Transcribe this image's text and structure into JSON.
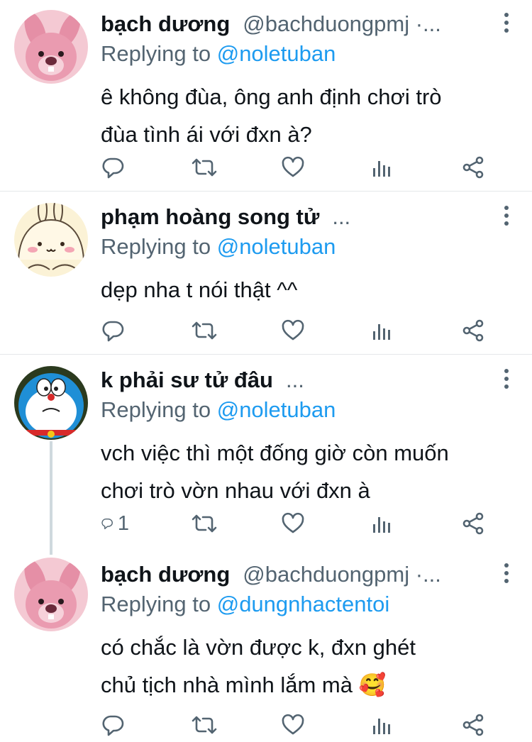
{
  "tweets": [
    {
      "name": "bạch dương",
      "handle": "@bachduongpmj ·...",
      "replying_prefix": "Replying to ",
      "replying_to": "@noletuban",
      "text_lines": [
        "ê không đùa, ông anh định chơi trò",
        "đùa tình ái với đxn à?"
      ],
      "reply_count": ""
    },
    {
      "name": "phạm hoàng song tử",
      "handle": "...",
      "replying_prefix": "Replying to ",
      "replying_to": "@noletuban",
      "text_lines": [
        "dẹp nha t nói thật ^^"
      ],
      "reply_count": ""
    },
    {
      "name": "k phải sư tử đâu",
      "handle": "...",
      "replying_prefix": "Replying to ",
      "replying_to": "@noletuban",
      "text_lines": [
        "vch việc thì một đống giờ còn muốn",
        "chơi trò vờn nhau với đxn à"
      ],
      "reply_count": "1"
    },
    {
      "name": "bạch dương",
      "handle": "@bachduongpmj ·...",
      "replying_prefix": "Replying to ",
      "replying_to": "@dungnhactentoi",
      "text_lines": [
        "có chắc là vờn được k, đxn ghét",
        "chủ tịch nhà mình lắm mà 🥰"
      ],
      "reply_count": ""
    }
  ],
  "icons": {
    "action_icons": [
      "reply-icon",
      "retweet-icon",
      "like-icon",
      "analytics-icon",
      "share-icon"
    ],
    "more": "more-vertical-icon"
  },
  "colors": {
    "text": "#0f1419",
    "secondary": "#536471",
    "link": "#1d9bf0",
    "divider": "#e5e7ea"
  }
}
